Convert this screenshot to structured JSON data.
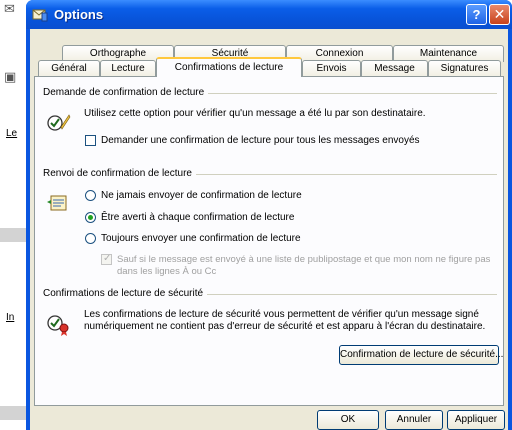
{
  "window": {
    "title": "Options",
    "help_label": "?",
    "close_label": "✕"
  },
  "tabs_row1": [
    "Orthographe",
    "Sécurité",
    "Connexion",
    "Maintenance"
  ],
  "tabs_row2": [
    "Général",
    "Lecture",
    "Confirmations de lecture",
    "Envois",
    "Message",
    "Signatures"
  ],
  "request_group": {
    "title": "Demande de confirmation de lecture",
    "description": "Utilisez cette option pour vérifier qu'un message a été lu par son destinataire.",
    "checkbox_label": "Demander une confirmation de lecture pour tous les messages envoyés",
    "checkbox_checked": false
  },
  "return_group": {
    "title": "Renvoi de confirmation de lecture",
    "options": [
      "Ne jamais envoyer de confirmation de lecture",
      "Être averti à chaque confirmation de lecture",
      "Toujours envoyer une confirmation de lecture"
    ],
    "selected_index": 1,
    "sub_checkbox_line1": "Sauf si le message est envoyé à une liste de publipostage et que mon nom ne figure pas",
    "sub_checkbox_line2": "dans les lignes À ou Cc",
    "sub_checkbox_checked": true
  },
  "secure_group": {
    "title": "Confirmations de lecture de sécurité",
    "description_line1": "Les confirmations de lecture de sécurité vous permettent de vérifier qu'un message signé",
    "description_line2": "numériquement ne contient pas d'erreur de sécurité et est apparu à l'écran du destinataire.",
    "button_label": "Confirmation de lecture de sécurité..."
  },
  "footer": {
    "ok": "OK",
    "cancel": "Annuler",
    "apply": "Appliquer"
  },
  "background": {
    "link1": "Le",
    "link2": "In"
  },
  "colors": {
    "titlebar": "#0a56e0",
    "dialog_bg": "#ece9d8",
    "panel_bg": "#fcfcfe",
    "active_tab_accent": "#ffc83c",
    "radio_dot": "#21a121"
  }
}
